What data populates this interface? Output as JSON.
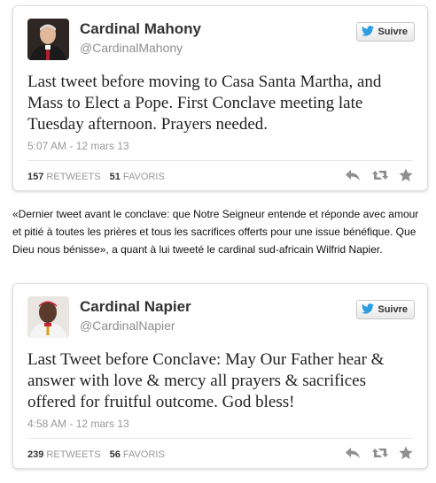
{
  "follow_label": "Suivre",
  "tweets": [
    {
      "name": "Cardinal Mahony",
      "handle": "@CardinalMahony",
      "text": "Last tweet before moving to Casa Santa Martha, and Mass to Elect a Pope. First Conclave meeting late Tuesday afternoon. Prayers needed.",
      "timestamp": "5:07 AM - 12 mars 13",
      "retweets": "157",
      "favorites": "51"
    },
    {
      "name": "Cardinal Napier",
      "handle": "@CardinalNapier",
      "text": "Last Tweet before Conclave: May Our Father hear & answer with love & mercy all prayers & sacrifices offered for fruitful outcome. God bless!",
      "timestamp": "4:58 AM - 12 mars 13",
      "retweets": "239",
      "favorites": "56"
    }
  ],
  "labels": {
    "retweets": "RETWEETS",
    "favorites": "FAVORIS"
  },
  "caption": "«Dernier tweet avant le conclave: que Notre Seigneur entende et réponde avec amour et pitié à toutes les prières et tous les sacrifices offerts pour une issue bénéfique. Que Dieu nous bénisse», a quant à lui tweeté le cardinal sud-africain Wilfrid Napier.",
  "colors": {
    "twitter_blue": "#2b9ee0",
    "icon_gray": "#8f8f8f"
  },
  "icons": [
    "twitter-bird-icon",
    "reply-icon",
    "retweet-icon",
    "favorite-star-icon"
  ]
}
